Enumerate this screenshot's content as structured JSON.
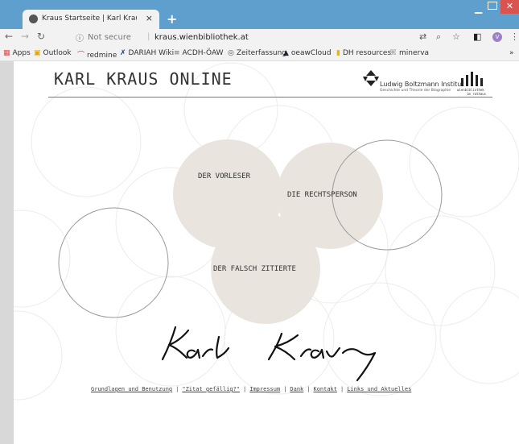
{
  "browser": {
    "tab_title": "Kraus Startseite | Karl Kraus Onlin",
    "tab_close": "×",
    "new_tab": "+",
    "not_secure": "Not secure",
    "url": "kraus.wienbibliothek.at",
    "bookmarks": [
      "Apps",
      "Outlook",
      "redmine",
      "DARIAH Wiki",
      "ACDH-ÖAW",
      "Zeiterfassung",
      "oeawCloud",
      "DH resources",
      "minerva"
    ],
    "more": "»"
  },
  "site": {
    "title": "KARL KRAUS ONLINE",
    "lbi_name": "Ludwig Boltzmann Institut",
    "lbi_sub": "Geschichte und Theorie der Biographie",
    "wb_line1": "wienbibliothek",
    "wb_line2": "im rathaus"
  },
  "menu": {
    "vorleser": "DER VORLESER",
    "rechtsperson": "DIE RECHTSPERSON",
    "falsch_zitierte": "DER FALSCH ZITIERTE"
  },
  "footer": {
    "links": [
      "Grundlagen und Benutzung",
      "\"Zitat gefällig?\"",
      "Impressum",
      "Dank",
      "Kontakt",
      "Links und Aktuelles"
    ],
    "separator": "|"
  },
  "colors": {
    "tabstrip": "#5e9fcd",
    "menu_circle": "#e9e5de",
    "close": "#d9534f"
  }
}
